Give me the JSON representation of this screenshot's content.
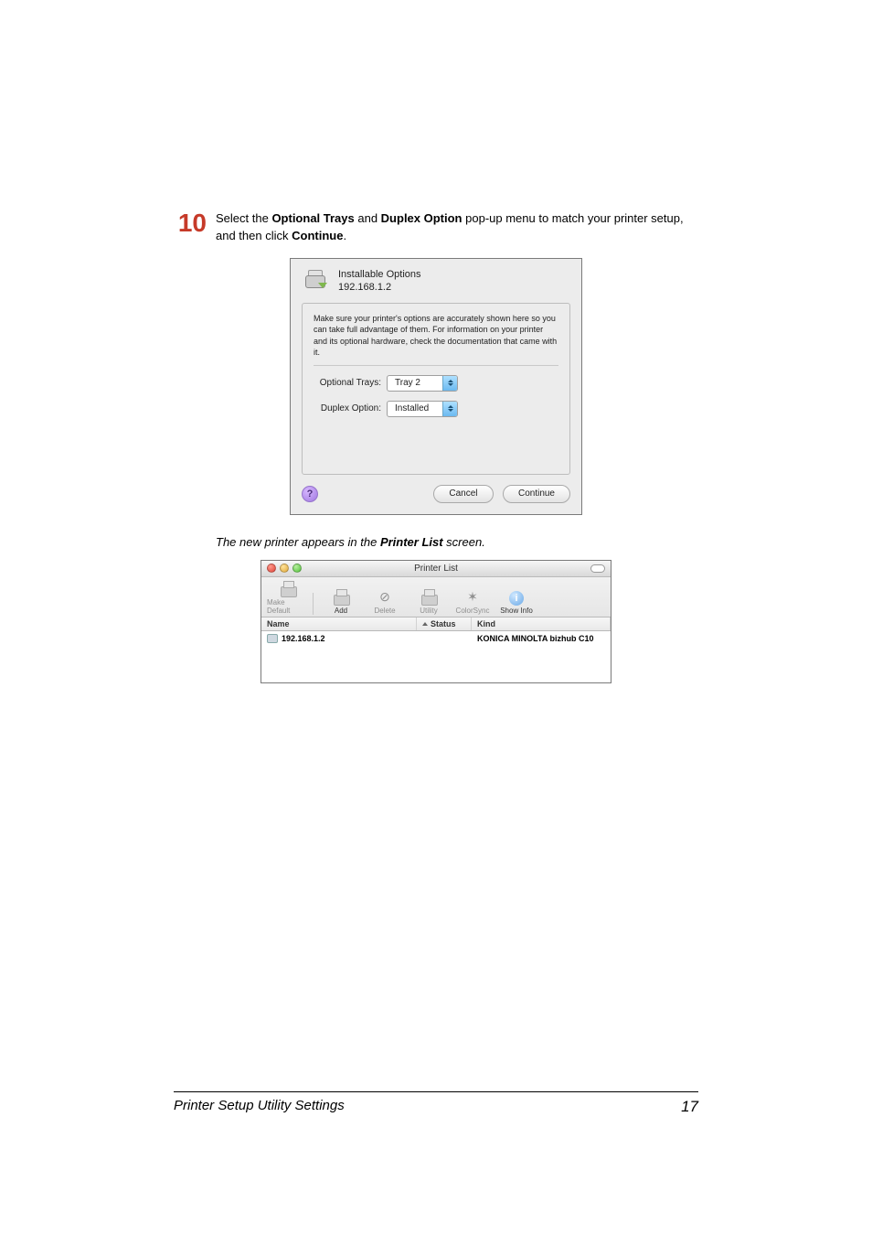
{
  "step": {
    "number": "10",
    "line1_a": "Select the ",
    "bold_a": "Optional Trays",
    "mid": " and ",
    "bold_b": "Duplex Option",
    "line1_b": " pop-up menu to match your printer setup, and then click ",
    "bold_c": "Continue",
    "tail": "."
  },
  "dialog": {
    "title": "Installable Options",
    "subtitle": "192.168.1.2",
    "message": "Make sure your printer's options are accurately shown here so you can take full advantage of them. For information on your printer and its optional hardware, check the documentation that came with it.",
    "row1_label": "Optional Trays:",
    "row1_value": "Tray 2",
    "row2_label": "Duplex Option:",
    "row2_value": "Installed",
    "help": "?",
    "cancel": "Cancel",
    "continue": "Continue"
  },
  "caption": {
    "pre": "The new printer appears in the ",
    "bold": "Printer List",
    "post": " screen."
  },
  "list": {
    "window_title": "Printer List",
    "toolbar": {
      "make_default": "Make Default",
      "add": "Add",
      "delete": "Delete",
      "utility": "Utility",
      "colorsync": "ColorSync",
      "show_info": "Show Info"
    },
    "cols": {
      "name": "Name",
      "status": "Status",
      "kind": "Kind"
    },
    "row": {
      "name": "192.168.1.2",
      "status": "",
      "kind": "KONICA MINOLTA bizhub C10"
    }
  },
  "footer": {
    "title": "Printer Setup Utility Settings",
    "page": "17"
  }
}
